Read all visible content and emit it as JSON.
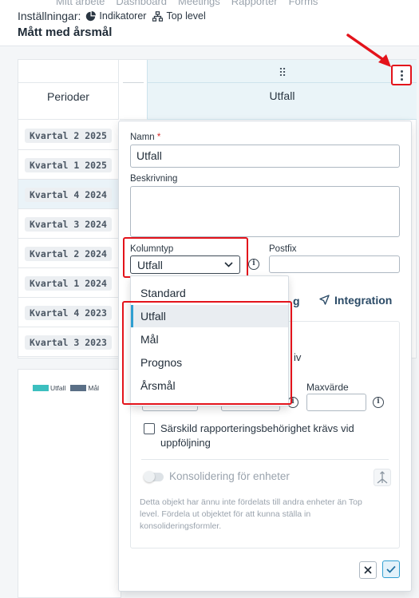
{
  "header": {
    "settings_label": "Inställningar:",
    "breadcrumb": [
      {
        "icon": "pie-chart-icon",
        "label": "Indikatorer"
      },
      {
        "icon": "hierarchy-icon",
        "label": "Top level"
      }
    ],
    "page_title": "Mått med årsmål"
  },
  "table": {
    "periods_header": "Perioder",
    "column_header": "Utfall",
    "drag_handle": "⠿",
    "rows": [
      {
        "period": "Kvartal 2 2025"
      },
      {
        "period": "Kvartal 1 2025"
      },
      {
        "period": "Kvartal 4 2024"
      },
      {
        "period": "Kvartal 3 2024"
      },
      {
        "period": "Kvartal 2 2024"
      },
      {
        "period": "Kvartal 1 2024"
      },
      {
        "period": "Kvartal 4 2023"
      },
      {
        "period": "Kvartal 3 2023"
      }
    ]
  },
  "chart_data": {
    "type": "bar",
    "series": [
      {
        "name": "Utfall",
        "color": "#3cbfbf",
        "values": []
      },
      {
        "name": "Mål",
        "color": "#5a6f86",
        "values": []
      }
    ]
  },
  "popover": {
    "name_label": "Namn",
    "required_mark": "*",
    "name_value": "Utfall",
    "description_label": "Beskrivning",
    "description_value": "",
    "column_type_label": "Kolumntyp",
    "column_type_value": "Utfall",
    "postfix_label": "Postfix",
    "postfix_value": "",
    "tab_partial": "g",
    "tab_integration": "Integration",
    "partial_text_iv": "iv",
    "max_label": "Maxvärde",
    "checkbox_label_line1": "Särskild rapporteringsbehörighet krävs vid",
    "checkbox_label_line2": "uppföljning",
    "toggle_label": "Konsolidering för enheter",
    "help_line1": "Detta objekt har ännu inte fördelats till andra enheter än Top",
    "help_line2": "level. Fördela ut objektet för att kunna ställa in",
    "help_line3": "konsolideringsformler.",
    "info_glyph": "i"
  },
  "dropdown": {
    "options": [
      "Standard",
      "Utfall",
      "Mål",
      "Prognos",
      "Årsmål"
    ],
    "selected": "Utfall"
  },
  "colors": {
    "highlight": "#e3131b",
    "accent": "#2f9fd1",
    "confirm": "#2f9fd1"
  }
}
